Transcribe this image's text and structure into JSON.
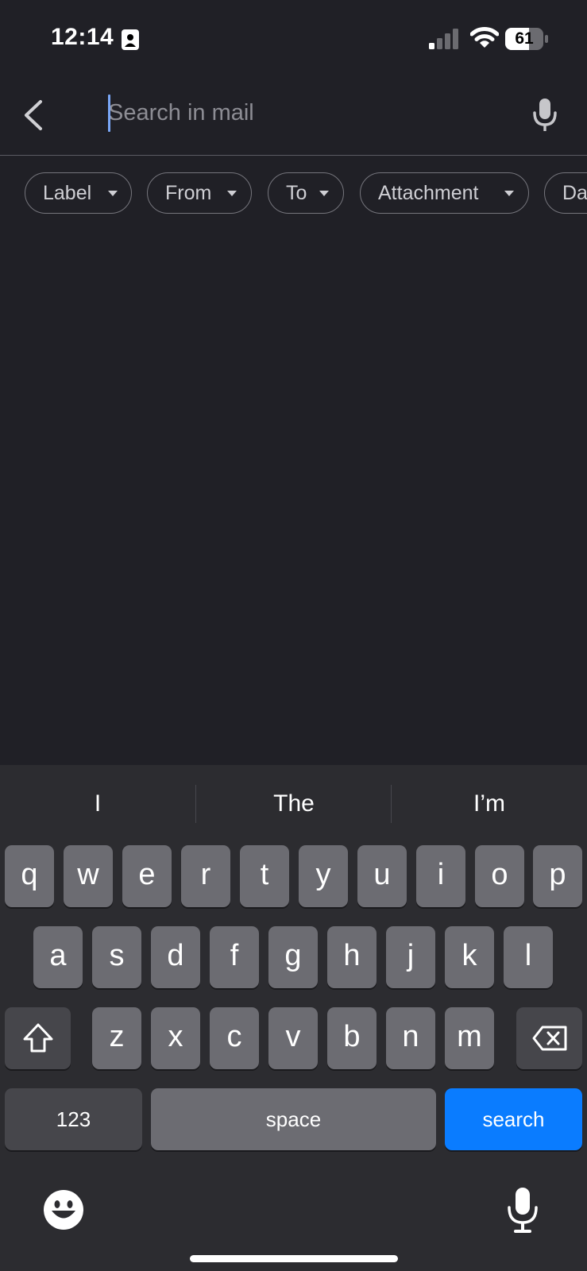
{
  "status_bar": {
    "time": "12:14",
    "battery": "61"
  },
  "search": {
    "placeholder": "Search in mail",
    "value": ""
  },
  "filters": [
    "Label",
    "From",
    "To",
    "Attachment",
    "Da"
  ],
  "suggestions": [
    "I",
    "The",
    "I’m"
  ],
  "keyboard": {
    "row1": [
      "q",
      "w",
      "e",
      "r",
      "t",
      "y",
      "u",
      "i",
      "o",
      "p"
    ],
    "row2": [
      "a",
      "s",
      "d",
      "f",
      "g",
      "h",
      "j",
      "k",
      "l"
    ],
    "row3": [
      "z",
      "x",
      "c",
      "v",
      "b",
      "n",
      "m"
    ],
    "numbers_label": "123",
    "space_label": "space",
    "search_label": "search"
  },
  "colors": {
    "background": "#202026",
    "keyboard": "#2c2c30",
    "key": "#6c6c72",
    "accent": "#0a7cff",
    "caret": "#7aa7f7"
  }
}
